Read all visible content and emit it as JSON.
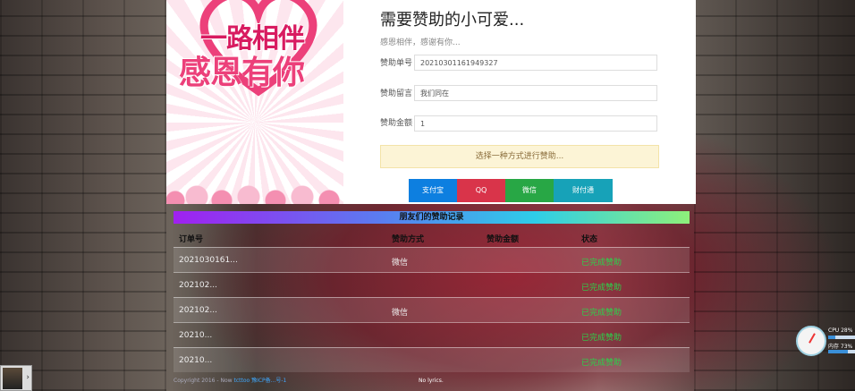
{
  "banner": {
    "line1": "一路相伴",
    "line2": "感恩有你"
  },
  "form": {
    "title": "需要赞助的小可爱...",
    "subtitle": "感恩相伴，感谢有你...",
    "order_label": "赞助单号",
    "order_value": "20210301161949327",
    "message_label": "赞助留言",
    "message_value": "我们同在",
    "amount_label": "赞助金额",
    "amount_value": "1",
    "hint": "选择一种方式进行赞助..."
  },
  "payment": {
    "alipay": "支付宝",
    "qq": "QQ",
    "wechat": "微信",
    "tenpay": "财付通"
  },
  "records": {
    "header": "朋友们的赞助记录",
    "columns": [
      "订单号",
      "赞助方式",
      "赞助金额",
      "状态"
    ],
    "rows": [
      {
        "order": "2021030161...",
        "method": "微信",
        "amount": "",
        "status": "已完成赞助"
      },
      {
        "order": "202102...",
        "method": "",
        "amount": "",
        "status": "已完成赞助"
      },
      {
        "order": "202102...",
        "method": "微信",
        "amount": "",
        "status": "已完成赞助"
      },
      {
        "order": "20210...",
        "method": "",
        "amount": "",
        "status": "已完成赞助"
      },
      {
        "order": "20210...",
        "method": "",
        "amount": "",
        "status": "已完成赞助"
      }
    ]
  },
  "footer": {
    "copyright": "Copyright 2016 - Now",
    "link": "tcttoo 豫ICP备...号-1"
  },
  "player": {
    "lyrics": "No lyrics."
  },
  "monitor": {
    "cpu": "CPU 28%",
    "mem": "内存 73%",
    "cpu_level": 0.28,
    "mem_level": 0.73
  }
}
